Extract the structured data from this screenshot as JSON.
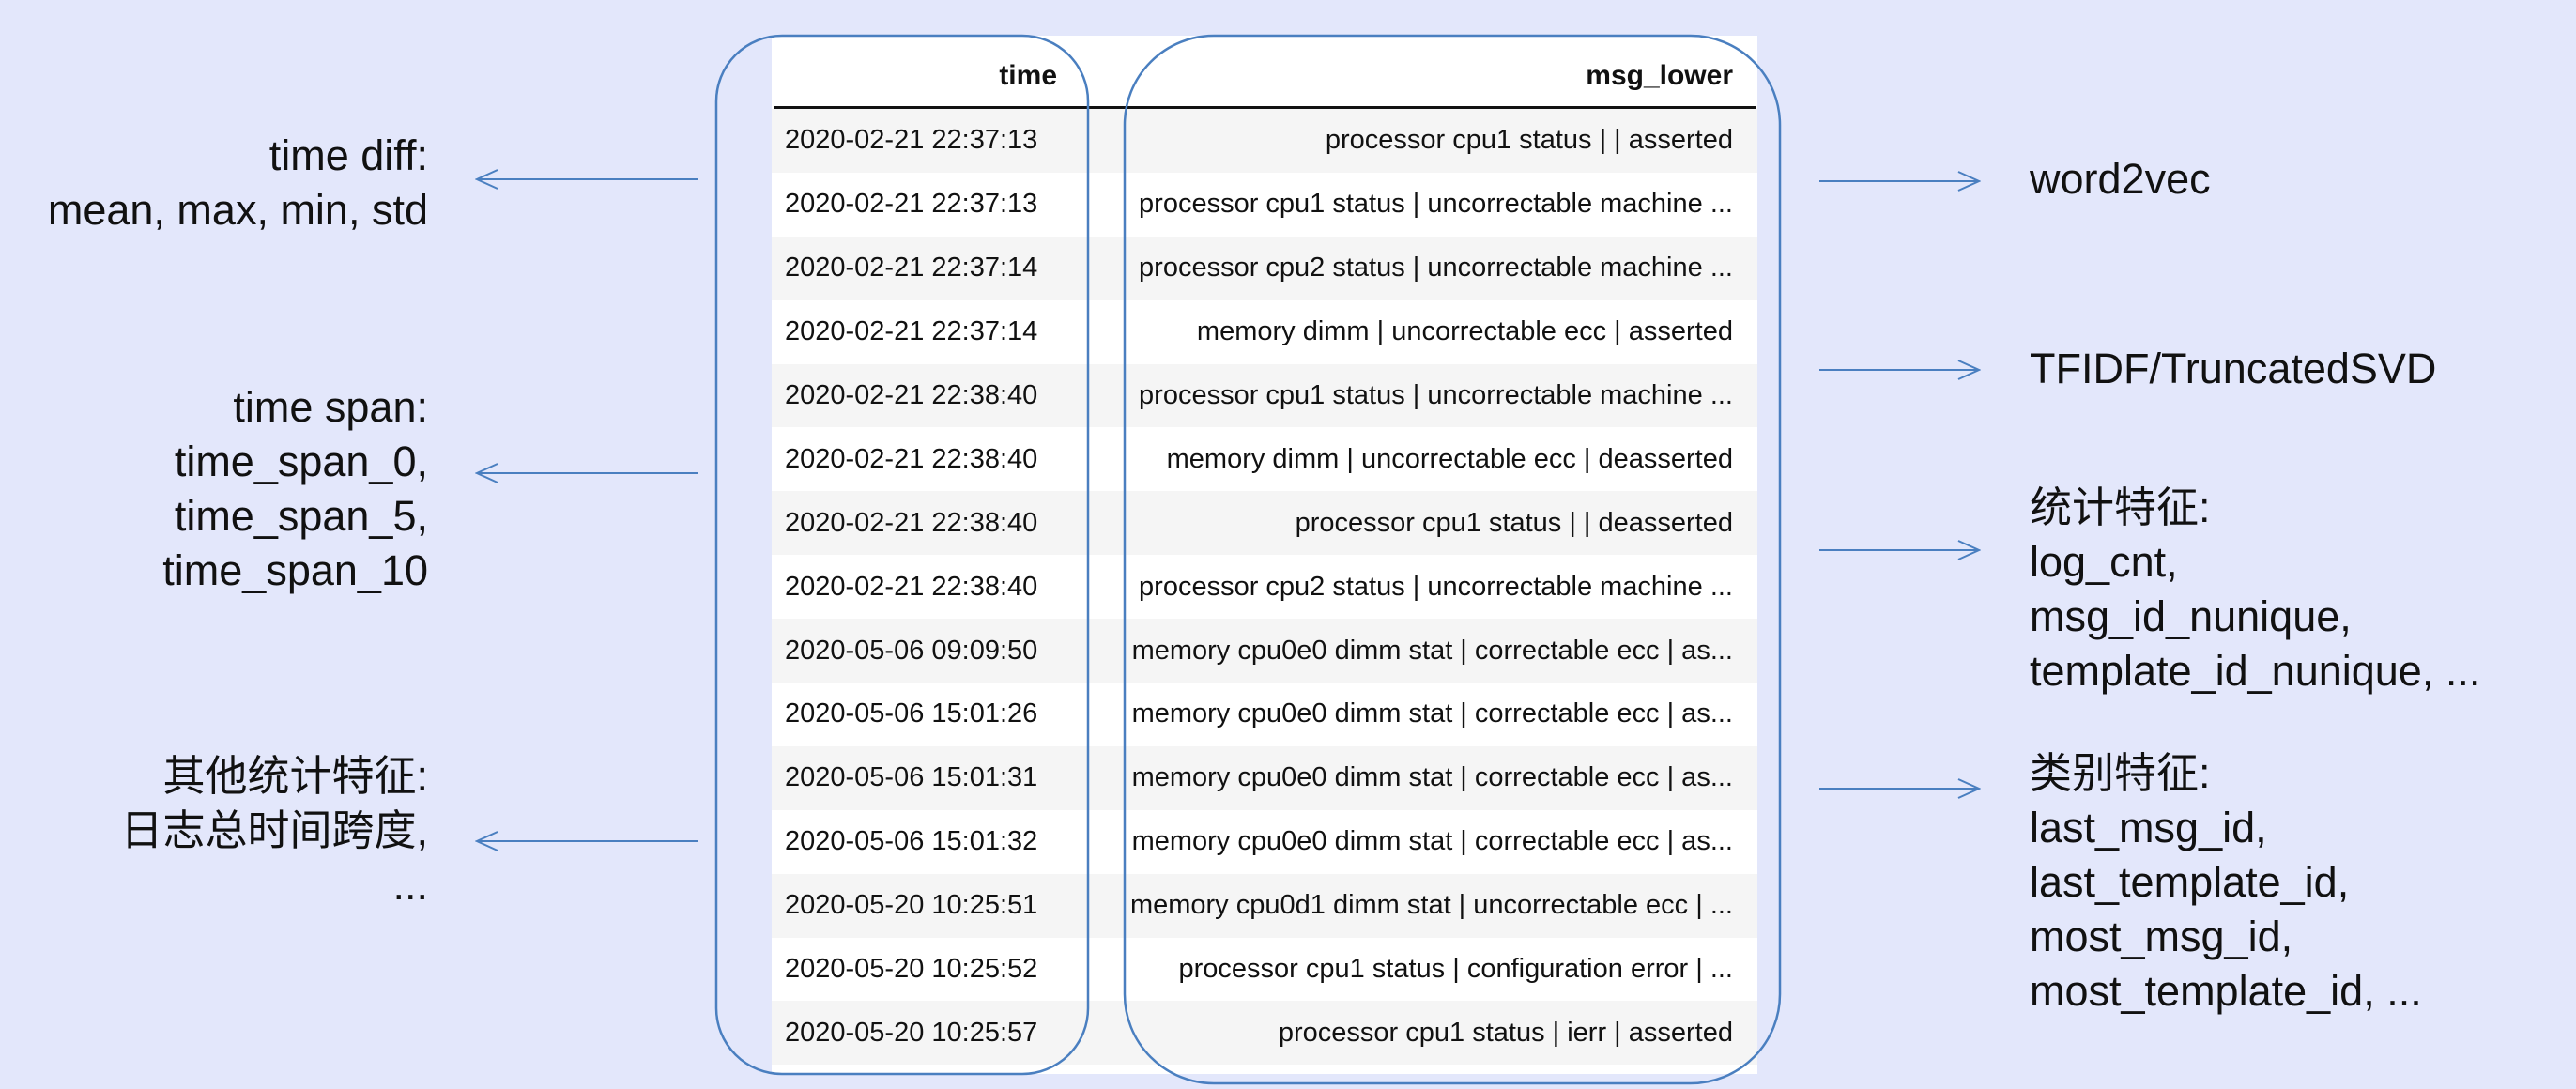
{
  "table": {
    "columns": [
      "time",
      "msg_lower"
    ],
    "rows": [
      {
        "time": "2020-02-21 22:37:13",
        "msg": "processor cpu1 status | | asserted"
      },
      {
        "time": "2020-02-21 22:37:13",
        "msg": "processor cpu1 status | uncorrectable machine ..."
      },
      {
        "time": "2020-02-21 22:37:14",
        "msg": "processor cpu2 status | uncorrectable machine ..."
      },
      {
        "time": "2020-02-21 22:37:14",
        "msg": "memory dimm | uncorrectable ecc | asserted"
      },
      {
        "time": "2020-02-21 22:38:40",
        "msg": "processor cpu1 status | uncorrectable machine ..."
      },
      {
        "time": "2020-02-21 22:38:40",
        "msg": "memory dimm | uncorrectable ecc | deasserted"
      },
      {
        "time": "2020-02-21 22:38:40",
        "msg": "processor cpu1 status | | deasserted"
      },
      {
        "time": "2020-02-21 22:38:40",
        "msg": "processor cpu2 status | uncorrectable machine ..."
      },
      {
        "time": "2020-05-06 09:09:50",
        "msg": "memory cpu0e0 dimm stat | correctable ecc | as..."
      },
      {
        "time": "2020-05-06 15:01:26",
        "msg": "memory cpu0e0 dimm stat | correctable ecc | as..."
      },
      {
        "time": "2020-05-06 15:01:31",
        "msg": "memory cpu0e0 dimm stat | correctable ecc | as..."
      },
      {
        "time": "2020-05-06 15:01:32",
        "msg": "memory cpu0e0 dimm stat | correctable ecc | as..."
      },
      {
        "time": "2020-05-20 10:25:51",
        "msg": "memory cpu0d1 dimm stat | uncorrectable ecc | ..."
      },
      {
        "time": "2020-05-20 10:25:52",
        "msg": "processor cpu1 status | configuration error | ..."
      },
      {
        "time": "2020-05-20 10:25:57",
        "msg": "processor cpu1 status | ierr | asserted"
      }
    ]
  },
  "left_labels": [
    {
      "lines": [
        "time diff:",
        "mean, max, min, std"
      ]
    },
    {
      "lines": [
        "time span:",
        "time_span_0,",
        "time_span_5,",
        "time_span_10"
      ]
    },
    {
      "lines": [
        "其他统计特征:",
        "日志总时间跨度,",
        "..."
      ]
    }
  ],
  "right_labels": [
    {
      "lines": [
        "word2vec"
      ]
    },
    {
      "lines": [
        "TFIDF/TruncatedSVD"
      ]
    },
    {
      "lines": [
        "统计特征:",
        "log_cnt,",
        "msg_id_nunique,",
        "template_id_nunique, ..."
      ]
    },
    {
      "lines": [
        "类别特征:",
        "last_msg_id,",
        "last_template_id,",
        "most_msg_id,",
        "most_template_id, ..."
      ]
    }
  ],
  "colors": {
    "background": "#e3e7fb",
    "outline_blue": "#4a7fc0",
    "row_stripe": "#f5f5f5"
  }
}
